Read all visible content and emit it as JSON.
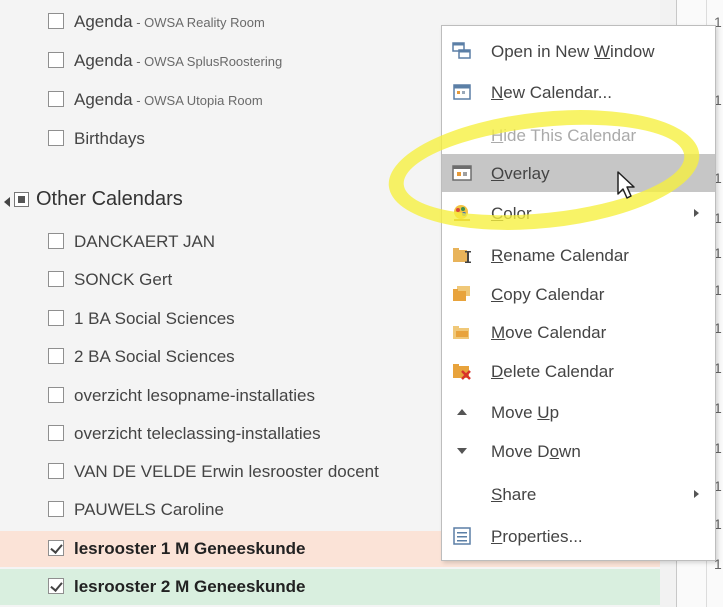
{
  "calendars": {
    "my_items": [
      {
        "label": "Agenda",
        "sub": " - OWSA Reality Room",
        "checked": false
      },
      {
        "label": "Agenda",
        "sub": " - OWSA SplusRoostering",
        "checked": false
      },
      {
        "label": "Agenda",
        "sub": " - OWSA Utopia Room",
        "checked": false
      },
      {
        "label": "Birthdays",
        "sub": "",
        "checked": false
      }
    ],
    "other_group_label": "Other Calendars",
    "other_items": [
      {
        "label": "DANCKAERT JAN",
        "checked": false
      },
      {
        "label": "SONCK Gert",
        "checked": false
      },
      {
        "label": "1 BA Social Sciences",
        "checked": false
      },
      {
        "label": "2 BA Social Sciences",
        "checked": false
      },
      {
        "label": "overzicht lesopname-installaties",
        "checked": false
      },
      {
        "label": "overzicht teleclassing-installaties",
        "checked": false
      },
      {
        "label": "VAN DE VELDE Erwin lesrooster docent",
        "checked": false
      },
      {
        "label": "PAUWELS Caroline",
        "checked": false
      },
      {
        "label": "lesrooster 1 M Geneeskunde",
        "checked": true,
        "highlight_color": "#fbe3d7"
      },
      {
        "label": "lesrooster 2 M Geneeskunde",
        "checked": true,
        "highlight_color": "#d9efdf"
      }
    ]
  },
  "context_menu": {
    "items": [
      {
        "pre": "Open in New ",
        "key": "W",
        "post": "indow",
        "icon": "new-window-icon"
      },
      {
        "pre": "",
        "key": "N",
        "post": "ew Calendar...",
        "icon": "new-calendar-icon"
      },
      {
        "pre": "",
        "key": "H",
        "post": "ide This Calendar",
        "icon": "",
        "disabled": true
      },
      {
        "pre": "",
        "key": "O",
        "post": "verlay",
        "icon": "overlay-icon",
        "hovered": true
      },
      {
        "pre": "",
        "key": "C",
        "post": "olor",
        "icon": "color-palette-icon",
        "submenu": true
      },
      {
        "pre": "",
        "key": "R",
        "post": "ename Calendar",
        "icon": "rename-calendar-icon"
      },
      {
        "pre": "",
        "key": "C",
        "post": "opy Calendar",
        "icon": "copy-calendar-icon"
      },
      {
        "pre": "",
        "key": "M",
        "post": "ove Calendar",
        "icon": "move-calendar-icon"
      },
      {
        "pre": "",
        "key": "D",
        "post": "elete Calendar",
        "icon": "delete-calendar-icon"
      },
      {
        "pre": "Move ",
        "key": "U",
        "post": "p",
        "icon": "move-up-icon"
      },
      {
        "pre": "Move D",
        "key": "o",
        "post": "wn",
        "icon": "move-down-icon"
      },
      {
        "pre": "",
        "key": "S",
        "post": "hare",
        "icon": "",
        "submenu": true
      },
      {
        "pre": "",
        "key": "P",
        "post": "roperties...",
        "icon": "properties-icon"
      }
    ]
  },
  "right_edge_digits": [
    "1",
    "1",
    "1",
    "1",
    "1",
    "1",
    "1",
    "1",
    "1",
    "1",
    "1",
    "1",
    "1"
  ],
  "colors": {
    "highlight_marker": "#f6f03c",
    "hover_bg": "#c6c6c6"
  }
}
